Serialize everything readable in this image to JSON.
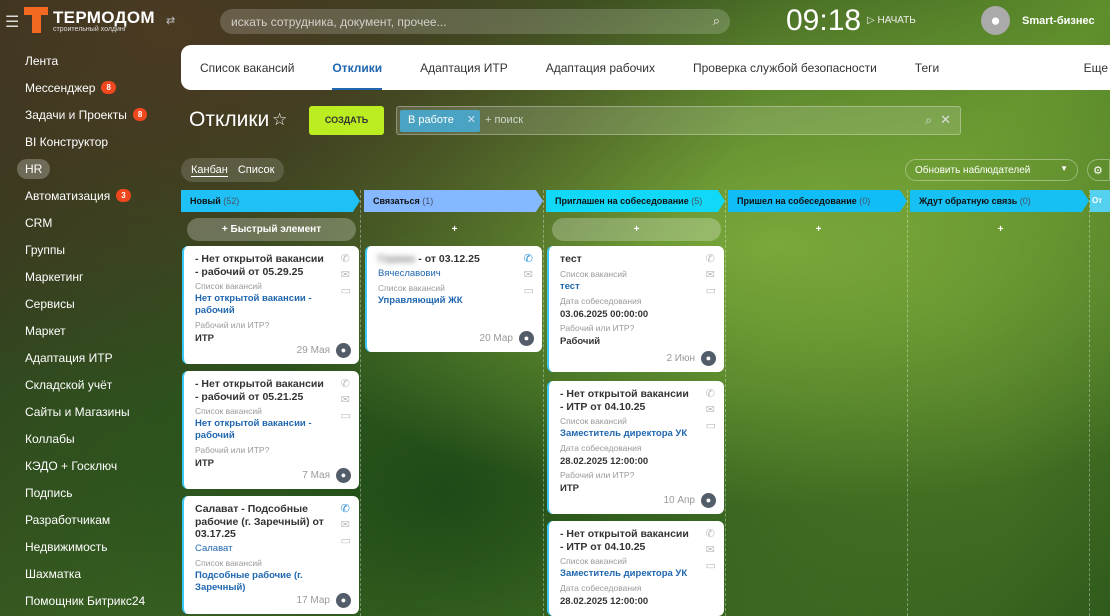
{
  "header": {
    "brand": "ТЕРМОДОМ",
    "brand_sub": "строительный холдинг",
    "search_placeholder": "искать сотрудника, документ, прочее...",
    "clock": "09:18",
    "start": "НАЧАТЬ",
    "user": "Smart-бизнес"
  },
  "sidebar": [
    {
      "label": "Лента"
    },
    {
      "label": "Мессенджер",
      "badge": "8"
    },
    {
      "label": "Задачи и Проекты",
      "badge": "8"
    },
    {
      "label": "BI Конструктор"
    },
    {
      "label": "HR",
      "selected": true
    },
    {
      "label": "Автоматизация",
      "badge": "3"
    },
    {
      "label": "CRM"
    },
    {
      "label": "Группы"
    },
    {
      "label": "Маркетинг"
    },
    {
      "label": "Сервисы"
    },
    {
      "label": "Маркет"
    },
    {
      "label": "Адаптация ИТР"
    },
    {
      "label": "Складской учёт"
    },
    {
      "label": "Сайты и Магазины"
    },
    {
      "label": "Коллабы"
    },
    {
      "label": "КЭДО + Госключ"
    },
    {
      "label": "Подпись"
    },
    {
      "label": "Разработчикам"
    },
    {
      "label": "Недвижимость"
    },
    {
      "label": "Шахматка"
    },
    {
      "label": "Помощник Битрикс24"
    }
  ],
  "tabs": [
    "Список вакансий",
    "Отклики",
    "Адаптация ИТР",
    "Адаптация рабочих",
    "Проверка службой безопасности",
    "Теги",
    "Еще"
  ],
  "toolbar": {
    "title": "Отклики",
    "create": "СОЗДАТЬ",
    "filter_chip": "В работе",
    "filter_placeholder": "+ поиск",
    "view_kanban": "Канбан",
    "view_list": "Список",
    "observers": "Обновить наблюдателей"
  },
  "quick_add": "Быстрый элемент",
  "columns": [
    {
      "title": "Новый",
      "count": "(52)",
      "color": "#1fc0f6"
    },
    {
      "title": "Связаться",
      "count": "(1)",
      "color": "#86b8ff"
    },
    {
      "title": "Приглашен на собеседование",
      "count": "(5)",
      "color": "#11d8f7"
    },
    {
      "title": "Пришел на собеседование",
      "count": "(0)",
      "color": "#11bdf7"
    },
    {
      "title": "Ждут обратную связь",
      "count": "(0)",
      "color": "#17c0f3"
    },
    {
      "title": "От",
      "count": "",
      "color": "#55d0ee"
    }
  ],
  "labels": {
    "vacancy_list": "Список вакансий",
    "worker_or_itr": "Рабочий или ИТР?",
    "interview_date": "Дата собеседования"
  },
  "cards": {
    "c1": [
      {
        "title": "- Нет открытой вакансии - рабочий от 05.29.25",
        "vacancy": "Нет открытой вакансии - рабочий",
        "type": "ИТР",
        "date": "29 Мая"
      },
      {
        "title": "- Нет открытой вакансии - рабочий от 05.21.25",
        "vacancy": "Нет открытой вакансии - рабочий",
        "type": "ИТР",
        "date": "7 Мая"
      },
      {
        "title": "Салават - Подсобные рабочие (г. Заречный) от 03.17.25",
        "contact": "Салават",
        "vacancy": "Подсобные рабочие (г. Заречный)",
        "date": "17 Мар"
      }
    ],
    "c2": [
      {
        "title_hidden": "Герман",
        "title": "- от 03.12.25",
        "contact": "Вячеславович",
        "vacancy": "Управляющий ЖК",
        "date": "20 Мар"
      }
    ],
    "c3": [
      {
        "title": "тест",
        "vacancy": "тест",
        "interview": "03.06.2025 00:00:00",
        "type": "Рабочий",
        "date": "2 Июн"
      },
      {
        "title": "- Нет открытой вакансии - ИТР от 04.10.25",
        "vacancy": "Заместитель директора УК",
        "interview": "28.02.2025 12:00:00",
        "type": "ИТР",
        "date": "10 Апр"
      },
      {
        "title": "- Нет открытой вакансии - ИТР от 04.10.25",
        "vacancy": "Заместитель директора УК",
        "interview": "28.02.2025 12:00:00"
      }
    ]
  }
}
